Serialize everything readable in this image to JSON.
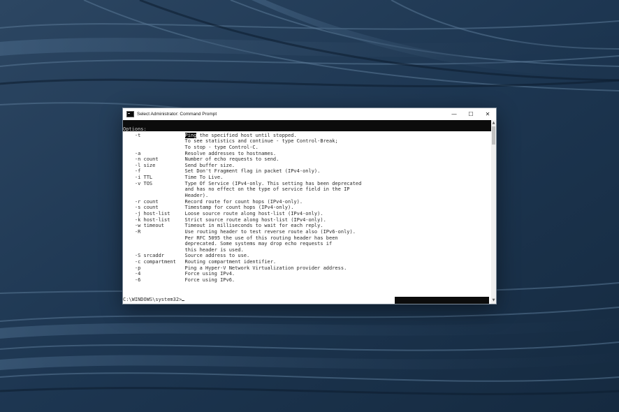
{
  "window": {
    "title": "Select Administrator: Command Prompt",
    "icon": "cmd-icon",
    "controls": {
      "minimize_glyph": "—",
      "maximize_glyph": "☐",
      "close_glyph": "✕"
    }
  },
  "console": {
    "lines": [
      {
        "option": "",
        "desc": "",
        "text": "Options:"
      },
      {
        "option": "    -t",
        "desc": "Ping the specified host until stopped.",
        "highlight": "Ping"
      },
      {
        "option": "",
        "desc": "To see statistics and continue - type Control-Break;"
      },
      {
        "option": "",
        "desc": "To stop - type Control-C."
      },
      {
        "option": "    -a",
        "desc": "Resolve addresses to hostnames."
      },
      {
        "option": "    -n count",
        "desc": "Number of echo requests to send."
      },
      {
        "option": "    -l size",
        "desc": "Send buffer size."
      },
      {
        "option": "    -f",
        "desc": "Set Don't Fragment flag in packet (IPv4-only)."
      },
      {
        "option": "    -i TTL",
        "desc": "Time To Live."
      },
      {
        "option": "    -v TOS",
        "desc": "Type Of Service (IPv4-only. This setting has been deprecated"
      },
      {
        "option": "",
        "desc": "and has no effect on the type of service field in the IP"
      },
      {
        "option": "",
        "desc": "Header)."
      },
      {
        "option": "    -r count",
        "desc": "Record route for count hops (IPv4-only)."
      },
      {
        "option": "    -s count",
        "desc": "Timestamp for count hops (IPv4-only)."
      },
      {
        "option": "    -j host-list",
        "desc": "Loose source route along host-list (IPv4-only)."
      },
      {
        "option": "    -k host-list",
        "desc": "Strict source route along host-list (IPv4-only)."
      },
      {
        "option": "    -w timeout",
        "desc": "Timeout in milliseconds to wait for each reply."
      },
      {
        "option": "    -R",
        "desc": "Use routing header to test reverse route also (IPv6-only)."
      },
      {
        "option": "",
        "desc": "Per RFC 5095 the use of this routing header has been"
      },
      {
        "option": "",
        "desc": "deprecated. Some systems may drop echo requests if"
      },
      {
        "option": "",
        "desc": "this header is used."
      },
      {
        "option": "    -S srcaddr",
        "desc": "Source address to use."
      },
      {
        "option": "    -c compartment",
        "desc": "Routing compartment identifier."
      },
      {
        "option": "    -p",
        "desc": "Ping a Hyper-V Network Virtualization provider address."
      },
      {
        "option": "    -4",
        "desc": "Force using IPv4."
      },
      {
        "option": "    -6",
        "desc": "Force using IPv6."
      }
    ],
    "prompt": "C:\\WINDOWS\\system32>"
  },
  "scrollbar": {
    "up_glyph": "▲",
    "down_glyph": "▼"
  },
  "colors": {
    "console_text": "#2a2a2a",
    "console_black": "#0c0c0c",
    "wallpaper_dark": "#172d44",
    "wallpaper_light": "#3d5a78"
  }
}
